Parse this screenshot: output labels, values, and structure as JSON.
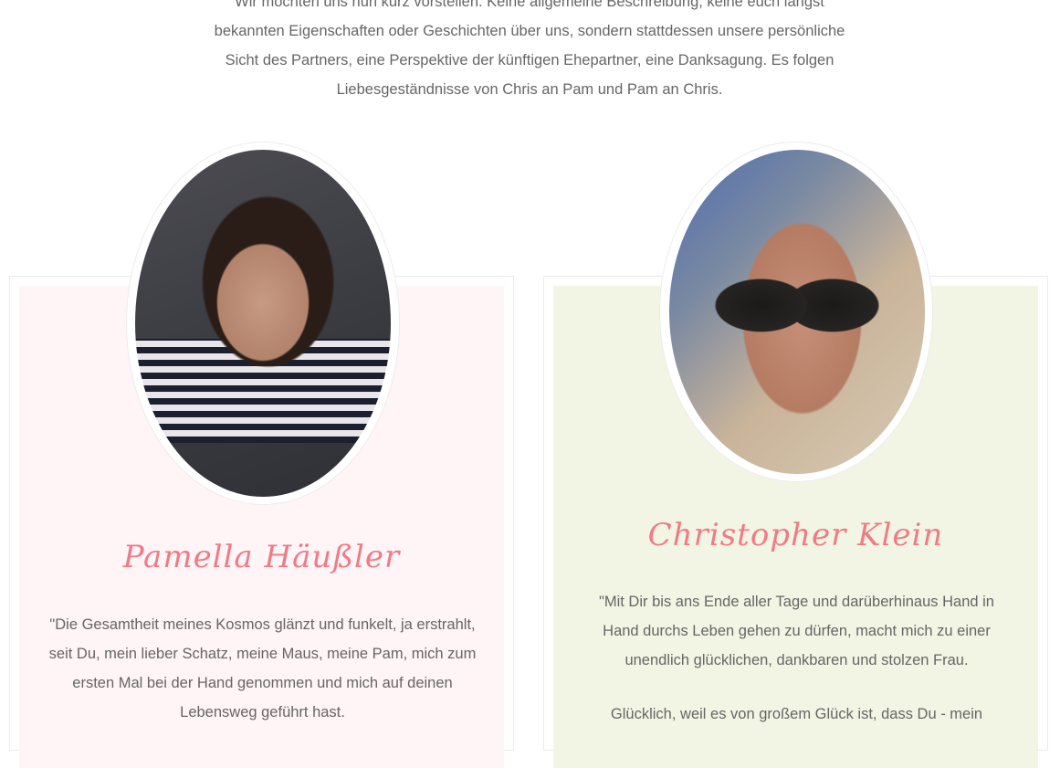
{
  "intro": {
    "text": "Wir möchten uns nun kurz vorstellen. Keine allgemeine Beschreibung, keine euch längst bekannten Eigenschaften oder Geschichten über uns, sondern stattdessen unsere persönliche Sicht des Partners, eine Perspektive der künftigen Ehepartner, eine Danksagung. Es folgen Liebesgeständnisse von Chris an Pam und Pam an Chris."
  },
  "colors": {
    "name_accent": "#ef7b86",
    "left_card_bg": "#fff4f6",
    "right_card_bg": "#f2f5e3",
    "body_text": "#666666"
  },
  "profiles": [
    {
      "name": "Pamella Häußler",
      "photo_icon": "portrait-woman-photo",
      "quote": "\"Die Gesamtheit meines Kosmos glänzt und funkelt, ja erstrahlt, seit Du, mein lieber Schatz, meine Maus, meine Pam, mich zum ersten Mal bei der Hand genommen und mich auf deinen Lebensweg geführt hast."
    },
    {
      "name": "Christopher Klein",
      "photo_icon": "portrait-man-sunglasses-photo",
      "quote": "\"Mit Dir bis ans Ende aller Tage und darüberhinaus Hand in Hand durchs Leben gehen zu dürfen, macht mich zu einer unendlich glücklichen, dankbaren und stolzen Frau.",
      "quote_2": "Glücklich, weil es von großem Glück ist, dass Du - mein"
    }
  ]
}
